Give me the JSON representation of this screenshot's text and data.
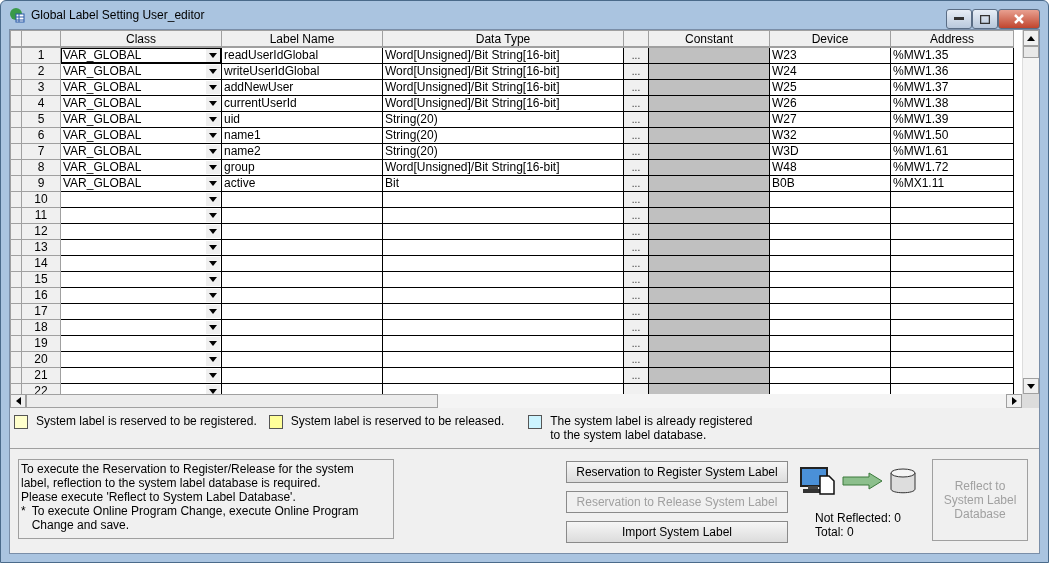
{
  "window": {
    "title": "Global Label Setting User_editor"
  },
  "table": {
    "columns": [
      "Class",
      "Label Name",
      "Data Type",
      "Constant",
      "Device",
      "Address"
    ],
    "rows": [
      {
        "no": "1",
        "class": "VAR_GLOBAL",
        "label": "readUserIdGlobal",
        "type": "Word[Unsigned]/Bit String[16-bit]",
        "browse": "...",
        "device": "W23",
        "address": "%MW1.35",
        "selected": true
      },
      {
        "no": "2",
        "class": "VAR_GLOBAL",
        "label": "writeUserIdGlobal",
        "type": "Word[Unsigned]/Bit String[16-bit]",
        "browse": "...",
        "device": "W24",
        "address": "%MW1.36",
        "selected": false
      },
      {
        "no": "3",
        "class": "VAR_GLOBAL",
        "label": "addNewUser",
        "type": "Word[Unsigned]/Bit String[16-bit]",
        "browse": "...",
        "device": "W25",
        "address": "%MW1.37",
        "selected": false
      },
      {
        "no": "4",
        "class": "VAR_GLOBAL",
        "label": "currentUserId",
        "type": "Word[Unsigned]/Bit String[16-bit]",
        "browse": "...",
        "device": "W26",
        "address": "%MW1.38",
        "selected": false
      },
      {
        "no": "5",
        "class": "VAR_GLOBAL",
        "label": "uid",
        "type": "String(20)",
        "browse": "...",
        "device": "W27",
        "address": "%MW1.39",
        "selected": false
      },
      {
        "no": "6",
        "class": "VAR_GLOBAL",
        "label": "name1",
        "type": "String(20)",
        "browse": "...",
        "device": "W32",
        "address": "%MW1.50",
        "selected": false
      },
      {
        "no": "7",
        "class": "VAR_GLOBAL",
        "label": "name2",
        "type": "String(20)",
        "browse": "...",
        "device": "W3D",
        "address": "%MW1.61",
        "selected": false
      },
      {
        "no": "8",
        "class": "VAR_GLOBAL",
        "label": "group",
        "type": "Word[Unsigned]/Bit String[16-bit]",
        "browse": "...",
        "device": "W48",
        "address": "%MW1.72",
        "selected": false
      },
      {
        "no": "9",
        "class": "VAR_GLOBAL",
        "label": "active",
        "type": "Bit",
        "browse": "...",
        "device": "B0B",
        "address": "%MX1.11",
        "selected": false
      },
      {
        "no": "10",
        "browse": "...",
        "selected": false
      },
      {
        "no": "11",
        "browse": "...",
        "selected": false
      },
      {
        "no": "12",
        "browse": "...",
        "selected": false
      },
      {
        "no": "13",
        "browse": "...",
        "selected": false
      },
      {
        "no": "14",
        "browse": "...",
        "selected": false
      },
      {
        "no": "15",
        "browse": "...",
        "selected": false
      },
      {
        "no": "16",
        "browse": "...",
        "selected": false
      },
      {
        "no": "17",
        "browse": "...",
        "selected": false
      },
      {
        "no": "18",
        "browse": "...",
        "selected": false
      },
      {
        "no": "19",
        "browse": "...",
        "selected": false
      },
      {
        "no": "20",
        "browse": "...",
        "selected": false
      },
      {
        "no": "21",
        "browse": "...",
        "selected": false
      },
      {
        "no": "22",
        "selected": false
      }
    ]
  },
  "legend": [
    {
      "text": "System label is reserved to be registered.",
      "color": "#ffffcc"
    },
    {
      "text": "System label is reserved to be released.",
      "color": "#ffff99"
    },
    {
      "text": "The system label is already registered to the system label database.",
      "color": "#ccf4ff"
    }
  ],
  "note": {
    "lines": [
      "To execute the Reservation to Register/Release for the system label, reflection to the system label database is required.",
      "Please execute 'Reflect to System Label Database'."
    ],
    "footnote_mark": "*",
    "footnote": "To execute Online Program Change, execute Online Program Change and save."
  },
  "buttons": [
    {
      "label": "Reservation to Register System Label",
      "disabled": false
    },
    {
      "label": "Reservation to Release System Label",
      "disabled": true
    },
    {
      "label": "Import System Label",
      "disabled": false
    }
  ],
  "status": {
    "not_reflected": "Not Reflected: 0",
    "total": "Total: 0"
  },
  "reflect_button": {
    "label": "Reflect to System Label Database",
    "disabled": true
  }
}
